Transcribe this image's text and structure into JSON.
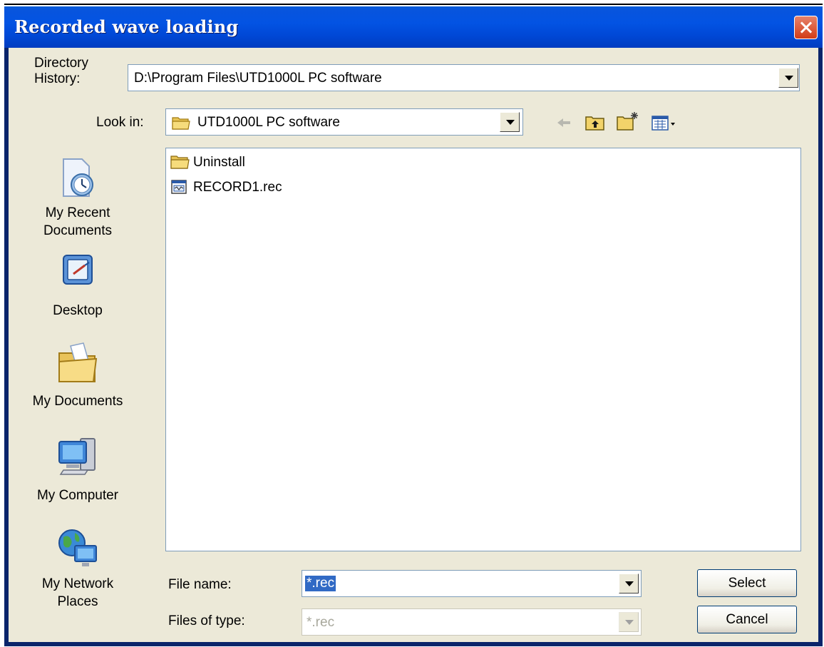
{
  "window": {
    "title": "Recorded wave loading"
  },
  "history": {
    "label": "Directory History:",
    "label_line1": "Directory",
    "label_line2": "History:",
    "value": "D:\\Program Files\\UTD1000L PC software"
  },
  "look_in": {
    "label": "Look in:",
    "value": "UTD1000L PC software"
  },
  "toolbar": {
    "icons": [
      "back-arrow-icon",
      "up-folder-icon",
      "new-folder-icon",
      "view-menu-icon"
    ]
  },
  "places": {
    "recent": {
      "line1": "My Recent",
      "line2": "Documents"
    },
    "desktop": {
      "label": "Desktop"
    },
    "documents": {
      "label": "My Documents"
    },
    "computer": {
      "label": "My Computer"
    },
    "network": {
      "line1": "My Network",
      "line2": "Places"
    }
  },
  "files": [
    {
      "name": "Uninstall",
      "type": "folder"
    },
    {
      "name": "RECORD1.rec",
      "type": "rec-file"
    }
  ],
  "file_name": {
    "label": "File name:",
    "value": "*.rec"
  },
  "file_type": {
    "label": "Files of type:",
    "value": "*.rec"
  },
  "buttons": {
    "select": "Select",
    "cancel": "Cancel"
  },
  "colors": {
    "title_bar": "#0353e3",
    "dialog_bg": "#ece9d8",
    "selection": "#316ac5",
    "close_button": "#d23c17"
  }
}
